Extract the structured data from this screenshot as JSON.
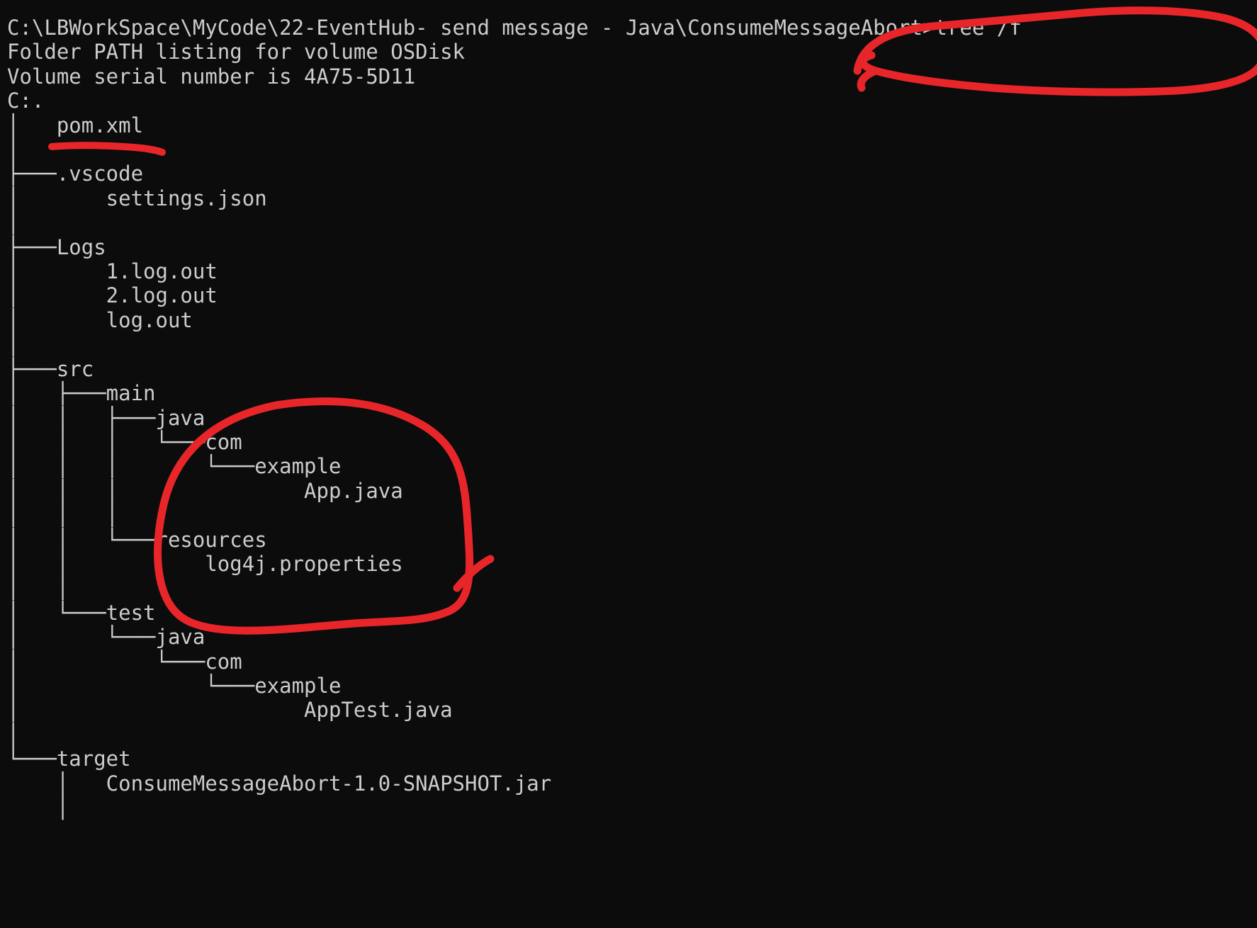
{
  "terminal": {
    "background_color": "#0c0c0c",
    "text_color": "#cccccc",
    "prompt_path": "C:\\LBWorkSpace\\MyCode\\22-EventHub- send message - Java\\ConsumeMessageAbort",
    "prompt_symbol": ">",
    "command": "tree /f",
    "prompt_line": "C:\\LBWorkSpace\\MyCode\\22-EventHub- send message - Java\\ConsumeMessageAbort>tree /f",
    "header_lines": [
      "Folder PATH listing for volume OSDisk",
      "Volume serial number is 4A75-5D11",
      "C:."
    ],
    "volume_label": "OSDisk",
    "volume_serial": "4A75-5D11",
    "root_marker": "C:.",
    "tree_lines": [
      "│   pom.xml",
      "│",
      "├───.vscode",
      "│       settings.json",
      "│",
      "├───Logs",
      "│       1.log.out",
      "│       2.log.out",
      "│       log.out",
      "│",
      "├───src",
      "│   ├───main",
      "│   │   ├───java",
      "│   │   │   └───com",
      "│   │   │       └───example",
      "│   │   │               App.java",
      "│   │   │",
      "│   │   └───resources",
      "│   │           log4j.properties",
      "│   │",
      "│   └───test",
      "│       └───java",
      "│           └───com",
      "│               └───example",
      "│                       AppTest.java",
      "│",
      "└───target",
      "    │   ConsumeMessageAbort-1.0-SNAPSHOT.jar",
      "    │"
    ]
  },
  "annotations": {
    "color": "#e8262a",
    "items": [
      {
        "name": "circle-around-tree-command",
        "shape": "ellipse-scribble",
        "target_text": "tree /f",
        "description": "Hand-drawn red ellipse circling the tree /f command at end of the prompt line"
      },
      {
        "name": "underline-pom-xml",
        "shape": "underline",
        "target_text": "pom.xml",
        "description": "Hand-drawn red underline beneath pom.xml"
      },
      {
        "name": "circle-around-main-java-tree",
        "shape": "ellipse-scribble",
        "target_text": "com / example / App.java / resources / log4j.properties",
        "description": "Large hand-drawn red ellipse encircling the src/main java package and resources subtree"
      }
    ]
  }
}
